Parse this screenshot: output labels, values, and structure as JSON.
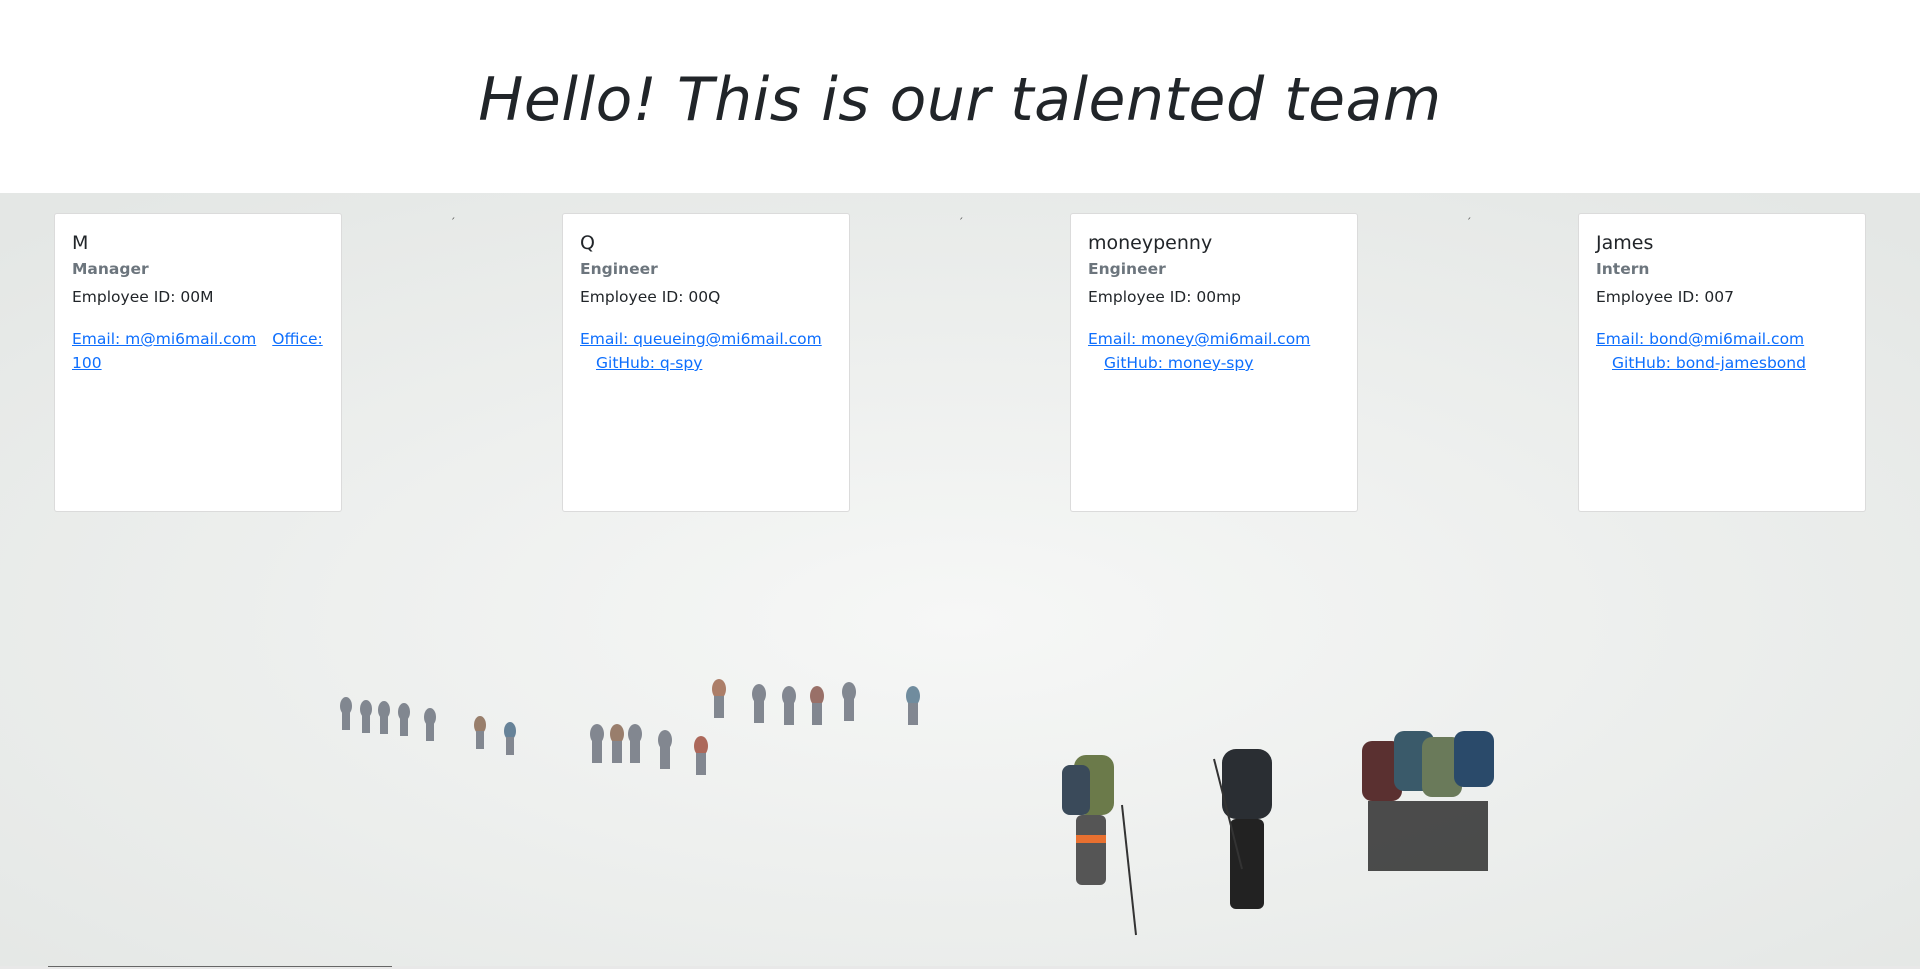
{
  "header": {
    "title": "Hello! This is our talented team"
  },
  "cards": [
    {
      "name": "M",
      "role": "Manager",
      "employee_id": "Employee ID: 00M",
      "email": "Email: m@mi6mail.com",
      "extra": "Office: 100"
    },
    {
      "name": "Q",
      "role": "Engineer",
      "employee_id": "Employee ID: 00Q",
      "email": "Email: queueing@mi6mail.com",
      "extra": "GitHub: q-spy"
    },
    {
      "name": "moneypenny",
      "role": "Engineer",
      "employee_id": "Employee ID: 00mp",
      "email": "Email: money@mi6mail.com",
      "extra": "GitHub: money-spy"
    },
    {
      "name": "James",
      "role": "Intern",
      "employee_id": "Employee ID: 007",
      "email": "Email: bond@mi6mail.com",
      "extra": "GitHub: bond-jamesbond"
    }
  ],
  "colors": {
    "link": "#0d6efd",
    "role": "#6c757d",
    "text": "#212529"
  }
}
